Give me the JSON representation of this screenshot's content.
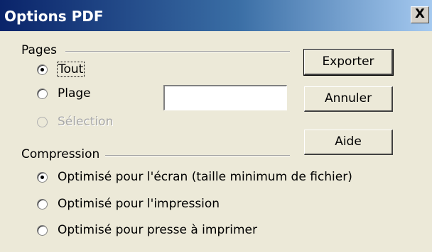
{
  "window": {
    "title": "Options PDF",
    "close_label": "X"
  },
  "pages_group": {
    "label": "Pages",
    "options": {
      "all": {
        "label": "Tout",
        "checked": true,
        "enabled": true
      },
      "range": {
        "label": "Plage",
        "checked": false,
        "enabled": true
      },
      "selection": {
        "label": "Sélection",
        "checked": false,
        "enabled": false
      }
    },
    "range_value": ""
  },
  "compression_group": {
    "label": "Compression",
    "options": {
      "screen": {
        "label": "Optimisé pour l'écran (taille minimum de fichier)",
        "checked": true
      },
      "print": {
        "label": "Optimisé pour l'impression",
        "checked": false
      },
      "press": {
        "label": "Optimisé pour presse à imprimer",
        "checked": false
      }
    }
  },
  "buttons": {
    "export": "Exporter",
    "cancel": "Annuler",
    "help": "Aide"
  }
}
